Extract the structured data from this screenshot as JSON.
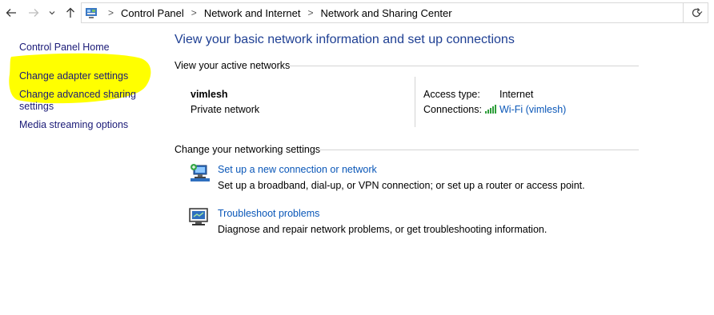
{
  "nav": {
    "back_icon": "arrow-left",
    "forward_icon": "arrow-right",
    "recent_icon": "chevron-down",
    "up_icon": "arrow-up",
    "refresh_icon": "refresh"
  },
  "breadcrumb": {
    "items": [
      "Control Panel",
      "Network and Internet",
      "Network and Sharing Center"
    ],
    "separator": ">"
  },
  "sidebar": {
    "items": [
      {
        "label": "Control Panel Home"
      },
      {
        "label": "Change adapter settings"
      },
      {
        "label": "Change advanced sharing"
      },
      {
        "label": "settings"
      },
      {
        "label": "Media streaming options"
      }
    ]
  },
  "main": {
    "title": "View your basic network information and set up connections",
    "active_networks_label": "View your active networks",
    "network": {
      "name": "vimlesh",
      "type": "Private network",
      "access_type_label": "Access type:",
      "access_type_value": "Internet",
      "connections_label": "Connections:",
      "connection_link": "Wi-Fi (vimlesh)"
    },
    "networking_settings_label": "Change your networking settings",
    "tasks": [
      {
        "link": "Set up a new connection or network",
        "description": "Set up a broadband, dial-up, or VPN connection; or set up a router or access point."
      },
      {
        "link": "Troubleshoot problems",
        "description": "Diagnose and repair network problems, or get troubleshooting information."
      }
    ]
  },
  "colors": {
    "title": "#1e3f93",
    "link": "#0a57b8",
    "sidebar_link": "#1a1a77",
    "highlight": "#ffff00",
    "wifi_bars": "#2e9e3a"
  }
}
